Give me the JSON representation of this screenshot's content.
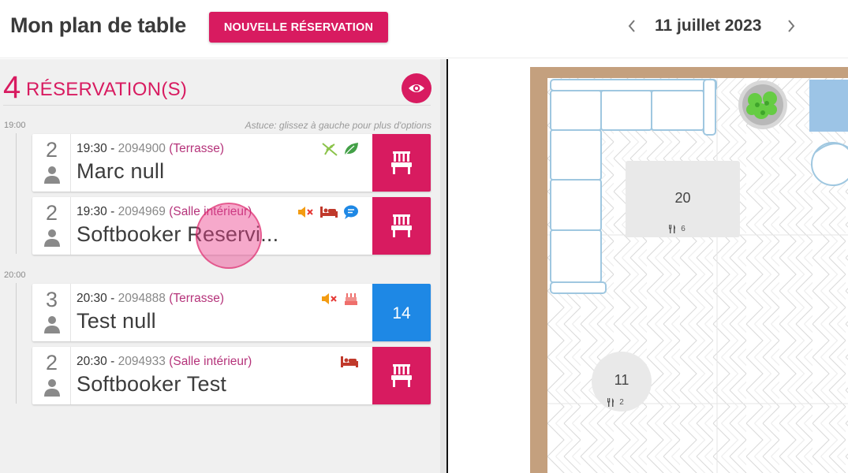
{
  "header": {
    "title": "Mon plan de table",
    "new_reservation_label": "NOUVELLE RÉSERVATION",
    "date": "11 juillet 2023"
  },
  "panel": {
    "count": "4",
    "count_label": "RÉSERVATION(S)",
    "tip": "Astuce: glissez à gauche pour plus d'options",
    "groups": [
      {
        "time": "19:00"
      },
      {
        "time": "20:00"
      }
    ],
    "reservations": [
      {
        "guests": "2",
        "time": "19:30",
        "sep": " - ",
        "id": "2094900",
        "room": "(Terrasse)",
        "name": "Marc null",
        "badges": [
          "no-gluten-icon",
          "leaf-icon"
        ],
        "table": ""
      },
      {
        "guests": "2",
        "time": "19:30",
        "sep": " - ",
        "id": "2094969",
        "room": "(Salle intérieur)",
        "name": "Softbooker Reservi...",
        "badges": [
          "mute-icon",
          "bed-icon",
          "comment-icon"
        ],
        "table": ""
      },
      {
        "guests": "3",
        "time": "20:30",
        "sep": " - ",
        "id": "2094888",
        "room": "(Terrasse)",
        "name": "Test null",
        "badges": [
          "mute-icon",
          "cake-icon"
        ],
        "table": "14"
      },
      {
        "guests": "2",
        "time": "20:30",
        "sep": " - ",
        "id": "2094933",
        "room": "(Salle intérieur)",
        "name": "Softbooker Test",
        "badges": [
          "bed-icon"
        ],
        "table": ""
      }
    ]
  },
  "floor": {
    "tables": [
      {
        "number": "20",
        "capacity": "6"
      },
      {
        "number": "11",
        "capacity": "2"
      }
    ]
  },
  "colors": {
    "accent": "#d81b60",
    "assigned_table": "#1e88e5",
    "room_text": "#b5337a"
  }
}
